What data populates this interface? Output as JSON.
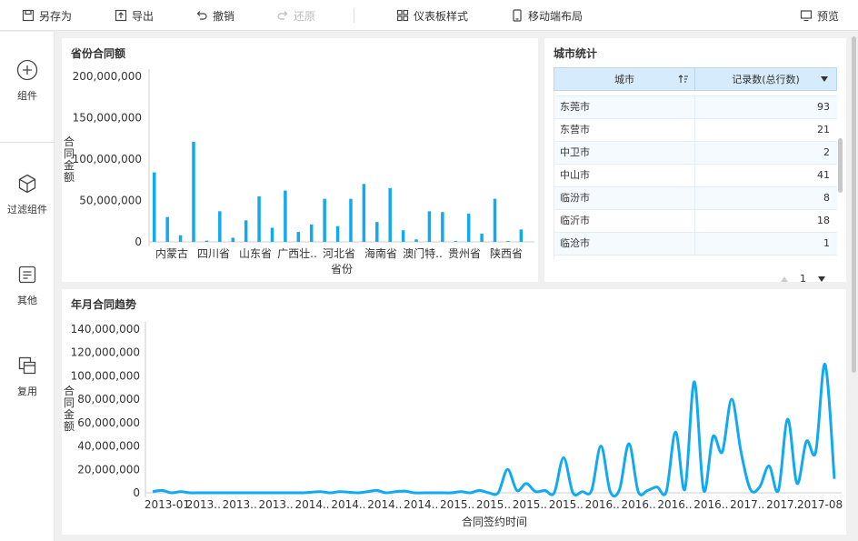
{
  "toolbar": {
    "save_as": "另存为",
    "export": "导出",
    "undo": "撤销",
    "redo": "还原",
    "dashboard_style": "仪表板样式",
    "mobile_layout": "移动端布局",
    "preview": "预览"
  },
  "sidebar": {
    "components": "组件",
    "filter_components": "过滤组件",
    "other": "其他",
    "reuse": "复用"
  },
  "colors": {
    "accent": "#11aaf0",
    "header_blue": "#d6ebfb"
  },
  "province_chart": {
    "panel_title": "省份合同额",
    "chart_data": {
      "type": "bar",
      "xlabel": "省份",
      "ylabel": "合同金额",
      "ylim": [
        0,
        200000000
      ],
      "y_ticks": [
        "200,000,000",
        "150,000,000",
        "100,000,000",
        "50,000,000",
        "0"
      ],
      "x_tick_labels": [
        "内蒙古",
        "四川省",
        "山东省",
        "广西壮..",
        "河北省",
        "海南省",
        "澳门特..",
        "贵州省",
        "陕西省"
      ],
      "values": [
        84000000,
        30000000,
        8000000,
        121000000,
        1500000,
        37000000,
        5000000,
        26000000,
        55000000,
        17000000,
        62000000,
        12000000,
        21000000,
        52000000,
        19000000,
        52000000,
        70000000,
        24000000,
        65000000,
        14000000,
        3000000,
        37000000,
        36000000,
        1000000,
        34000000,
        10000000,
        52000000,
        1000000,
        15000000
      ]
    }
  },
  "city_table": {
    "panel_title": "城市统计",
    "columns": [
      "城市",
      "记录数(总行数)"
    ],
    "rows": [
      {
        "city": "东莞市",
        "count": "93"
      },
      {
        "city": "东营市",
        "count": "21"
      },
      {
        "city": "中卫市",
        "count": "2"
      },
      {
        "city": "中山市",
        "count": "41"
      },
      {
        "city": "临汾市",
        "count": "8"
      },
      {
        "city": "临沂市",
        "count": "18"
      },
      {
        "city": "临沧市",
        "count": "1"
      }
    ],
    "page": "1"
  },
  "trend_chart": {
    "panel_title": "年月合同趋势",
    "chart_data": {
      "type": "line",
      "xlabel": "合同签约时间",
      "ylabel": "合同金额",
      "ylim": [
        0,
        140000000
      ],
      "y_ticks": [
        "140,000,000",
        "120,000,000",
        "100,000,000",
        "80,000,000",
        "60,000,000",
        "40,000,000",
        "20,000,000",
        "0"
      ],
      "x_tick_labels": [
        "2013-01",
        "2013..",
        "2013..",
        "2013..",
        "2014..",
        "2014..",
        "2014..",
        "2014..",
        "2015..",
        "2015..",
        "2015..",
        "2015..",
        "2016..",
        "2016..",
        "2016..",
        "2016..",
        "2017..",
        "2017..",
        "2017-08"
      ],
      "values": [
        1000000,
        2000000,
        0,
        1000000,
        0,
        0,
        0,
        0,
        0,
        0,
        0,
        0,
        0,
        0,
        0,
        0,
        0,
        500000,
        1000000,
        0,
        1000000,
        500000,
        0,
        1000000,
        2000000,
        0,
        1000000,
        1500000,
        0,
        0,
        0,
        0,
        0,
        1000000,
        0,
        2000000,
        0,
        0,
        20000000,
        2000000,
        8000000,
        1000000,
        2000000,
        0,
        30000000,
        0,
        1000000,
        2000000,
        40000000,
        1000000,
        3000000,
        42000000,
        1000000,
        2000000,
        5000000,
        1000000,
        52000000,
        3000000,
        95000000,
        2000000,
        48000000,
        35000000,
        80000000,
        35000000,
        3000000,
        5000000,
        23000000,
        2000000,
        63000000,
        8000000,
        44000000,
        35000000,
        110000000,
        12000000
      ]
    }
  }
}
